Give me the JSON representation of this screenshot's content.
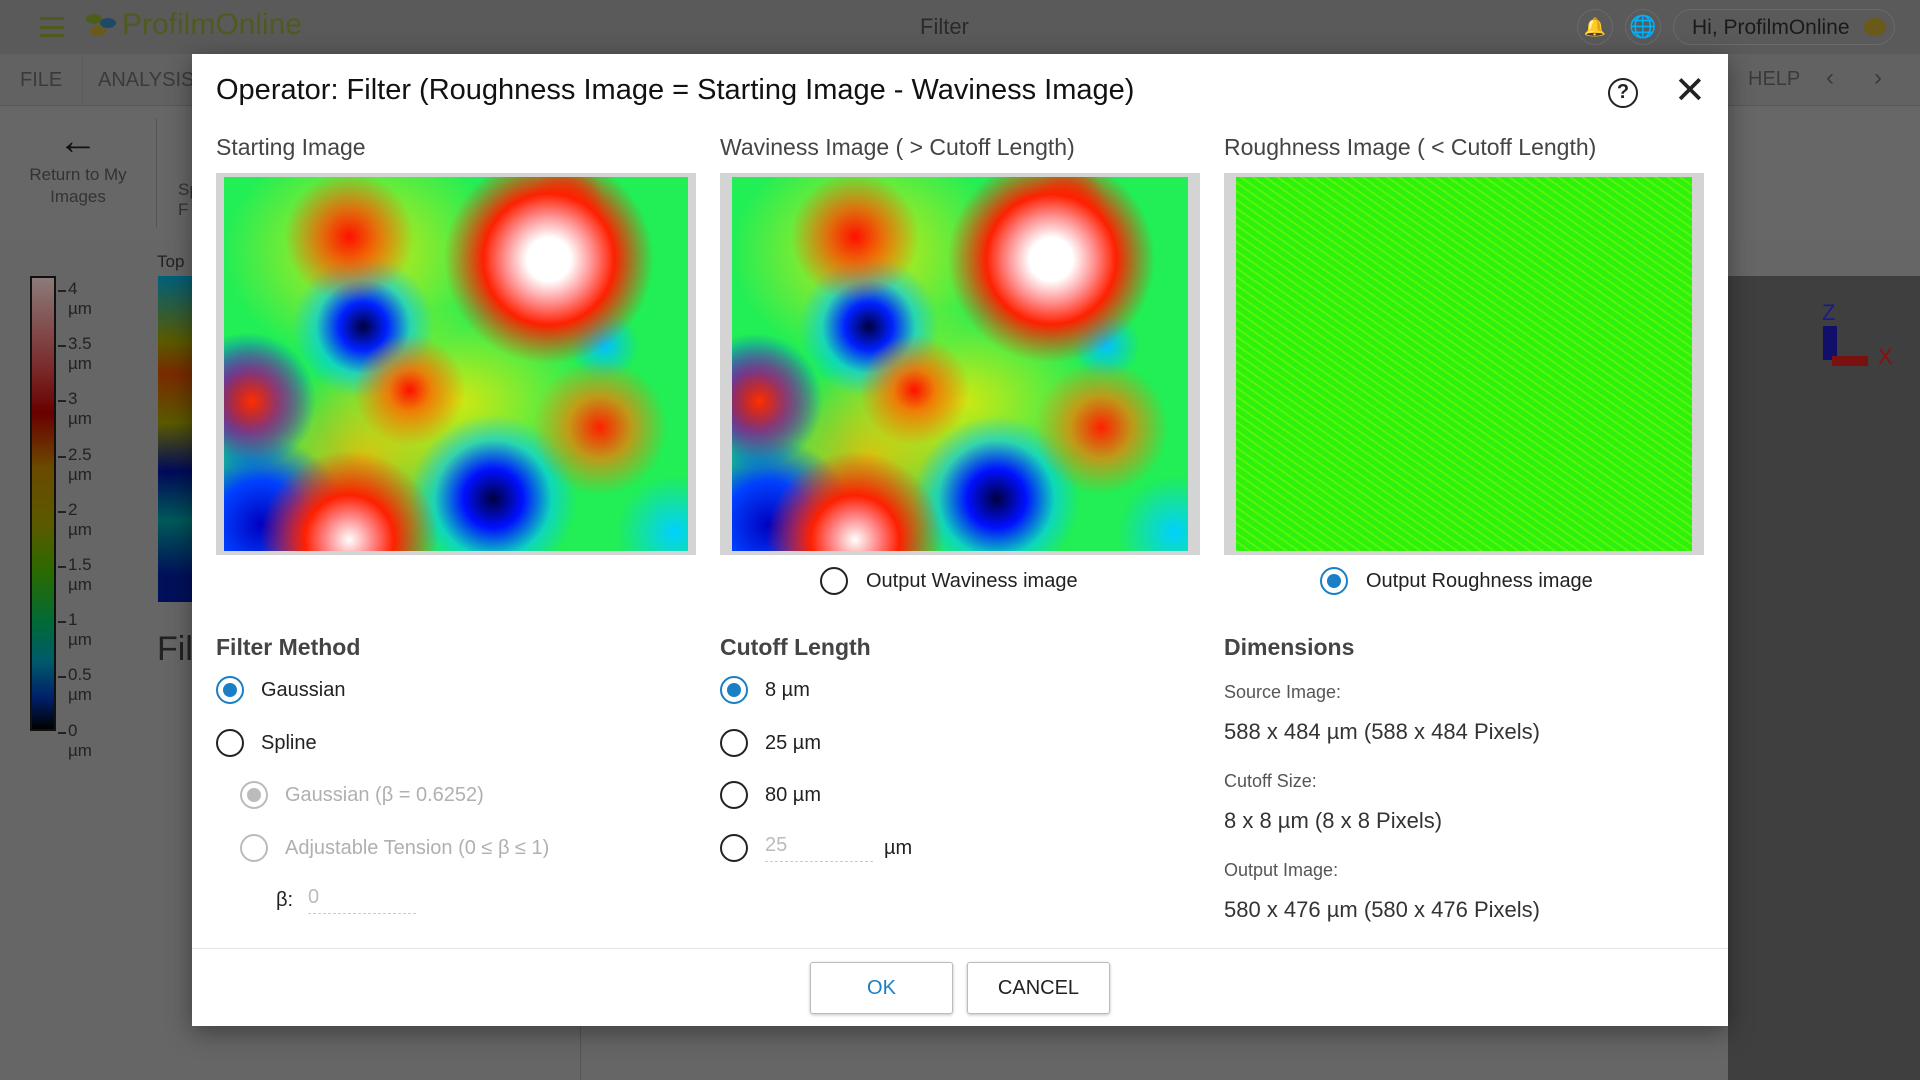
{
  "app": {
    "brand": "ProfilmOnline",
    "page_title": "Filter",
    "greeting": "Hi, ProfilmOnline"
  },
  "menu": {
    "items": [
      "FILE",
      "ANALYSIS"
    ],
    "help": "HELP"
  },
  "toolbar": {
    "return_label": "Return to My Images",
    "partial_label": "Sp F"
  },
  "background": {
    "view_label": "Top",
    "heading_partial": "Fil",
    "axis_labels": {
      "z": "Z",
      "x": "X"
    },
    "colorbar_ticks": [
      "4 µm",
      "3.5 µm",
      "3 µm",
      "2.5 µm",
      "2 µm",
      "1.5 µm",
      "1 µm",
      "0.5 µm",
      "0 µm"
    ]
  },
  "dialog": {
    "title": "Operator: Filter (Roughness Image = Starting Image - Waviness Image)",
    "columns": {
      "start": "Starting Image",
      "waviness": "Waviness Image ( > Cutoff Length)",
      "roughness": "Roughness Image ( < Cutoff Length)"
    },
    "output": {
      "waviness": "Output Waviness image",
      "roughness": "Output Roughness image",
      "selected": "roughness"
    },
    "filter_method": {
      "heading": "Filter Method",
      "options": [
        "Gaussian",
        "Spline"
      ],
      "selected": "Gaussian",
      "spline_options": [
        "Gaussian (β = 0.6252)",
        "Adjustable Tension (0 ≤ β ≤ 1)"
      ],
      "spline_selected": "Gaussian (β = 0.6252)",
      "beta_label": "β:",
      "beta_value": "0"
    },
    "cutoff": {
      "heading": "Cutoff Length",
      "options": [
        "8 µm",
        "25 µm",
        "80 µm"
      ],
      "selected": "8 µm",
      "custom_value": "25",
      "custom_unit": "µm"
    },
    "dimensions": {
      "heading": "Dimensions",
      "source_label": "Source Image:",
      "source_value": "588 x 484 µm (588 x 484 Pixels)",
      "cutoff_label": "Cutoff Size:",
      "cutoff_value": "8 x 8 µm (8 x 8 Pixels)",
      "output_label": "Output Image:",
      "output_value": "580 x 476 µm (580 x 476 Pixels)"
    },
    "buttons": {
      "ok": "OK",
      "cancel": "CANCEL"
    },
    "colors": {
      "accent": "#1a7fc4"
    }
  }
}
